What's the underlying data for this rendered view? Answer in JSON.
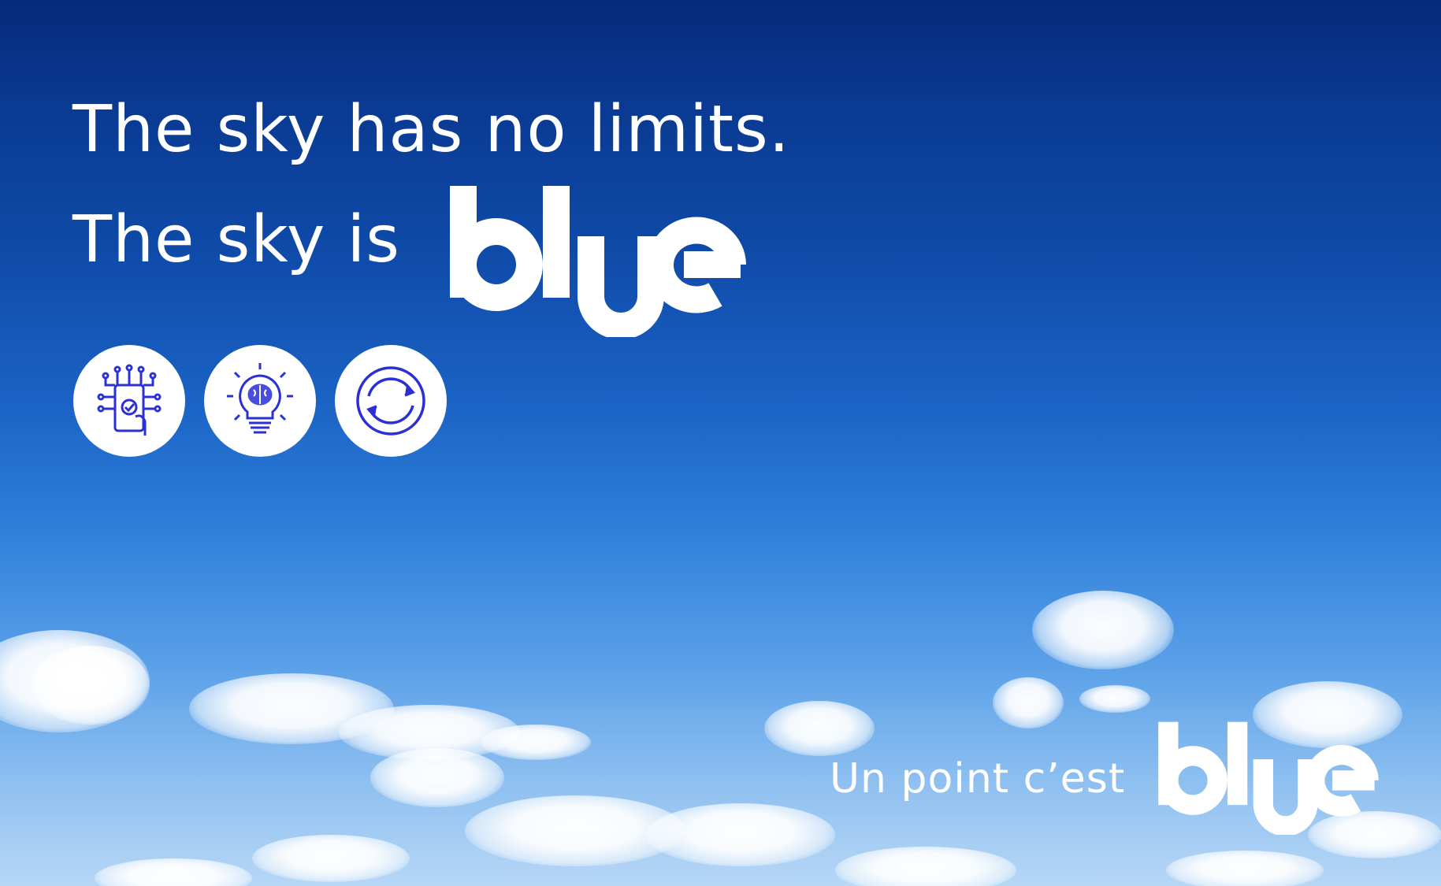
{
  "headline": {
    "line1": "The sky has no limits.",
    "line2": "The sky is"
  },
  "brand": {
    "logo_text": "blue",
    "tagline": "Un point c’est",
    "color": "#ffffff"
  },
  "icons": [
    {
      "name": "touchscreen-circuit-icon"
    },
    {
      "name": "lightbulb-brain-icon"
    },
    {
      "name": "refresh-cycle-icon"
    }
  ],
  "colors": {
    "sky_top": "#052a7a",
    "sky_bottom": "#b7d7f6",
    "icon_blue": "#2a2fd6"
  }
}
